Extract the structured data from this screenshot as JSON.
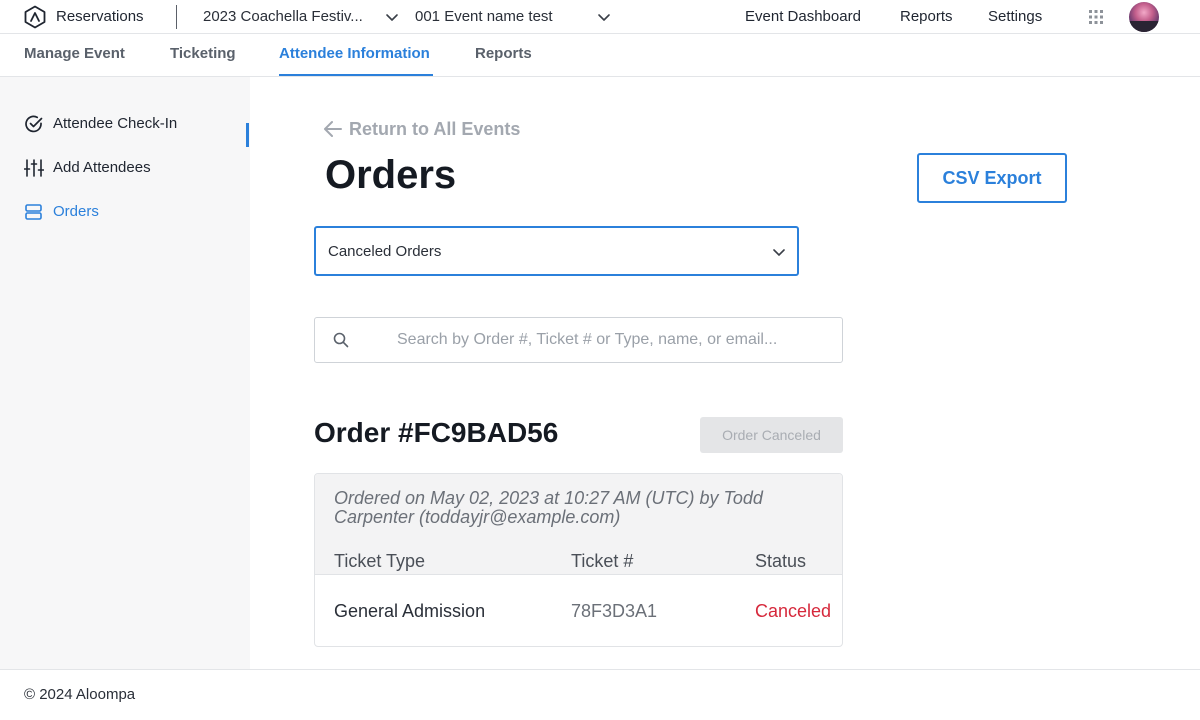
{
  "topbar": {
    "app_title": "Reservations",
    "event_select": "2023 Coachella Festiv...",
    "sub_select": "001 Event name test",
    "nav": {
      "dashboard": "Event Dashboard",
      "reports": "Reports",
      "settings": "Settings"
    },
    "icons": [
      "logo-icon",
      "chevron-down-icon",
      "apps-grid-icon",
      "avatar"
    ]
  },
  "tabs": [
    {
      "label": "Manage Event",
      "active": false
    },
    {
      "label": "Ticketing",
      "active": false
    },
    {
      "label": "Attendee Information",
      "active": true
    },
    {
      "label": "Reports",
      "active": false
    }
  ],
  "sidebar": {
    "items": [
      {
        "label": "Attendee Check-In",
        "icon": "check-circle-icon",
        "active": false
      },
      {
        "label": "Add Attendees",
        "icon": "sliders-icon",
        "active": false
      },
      {
        "label": "Orders",
        "icon": "server-icon",
        "active": true
      }
    ]
  },
  "main": {
    "back_link": "Return to All Events",
    "title": "Orders",
    "csv_button": "CSV Export",
    "filter_select": "Canceled Orders",
    "search_placeholder": "Search by Order #, Ticket # or Type, name, or email...",
    "order": {
      "title": "Order #FC9BAD56",
      "status_button": "Order Canceled",
      "ordered_on": "Ordered on May 02, 2023 at 10:27 AM (UTC) by Todd Carpenter (toddayjr@example.com)",
      "columns": [
        "Ticket Type",
        "Ticket #",
        "Status"
      ],
      "rows": [
        {
          "ticket_type": "General Admission",
          "ticket_number": "78F3D3A1",
          "status": "Canceled"
        }
      ]
    }
  },
  "colors": {
    "accent": "#2b80db",
    "canceled": "#d6283b",
    "sidebar_bg": "#f7f7f8"
  },
  "footer": {
    "copyright": "© 2024 Aloompa"
  }
}
